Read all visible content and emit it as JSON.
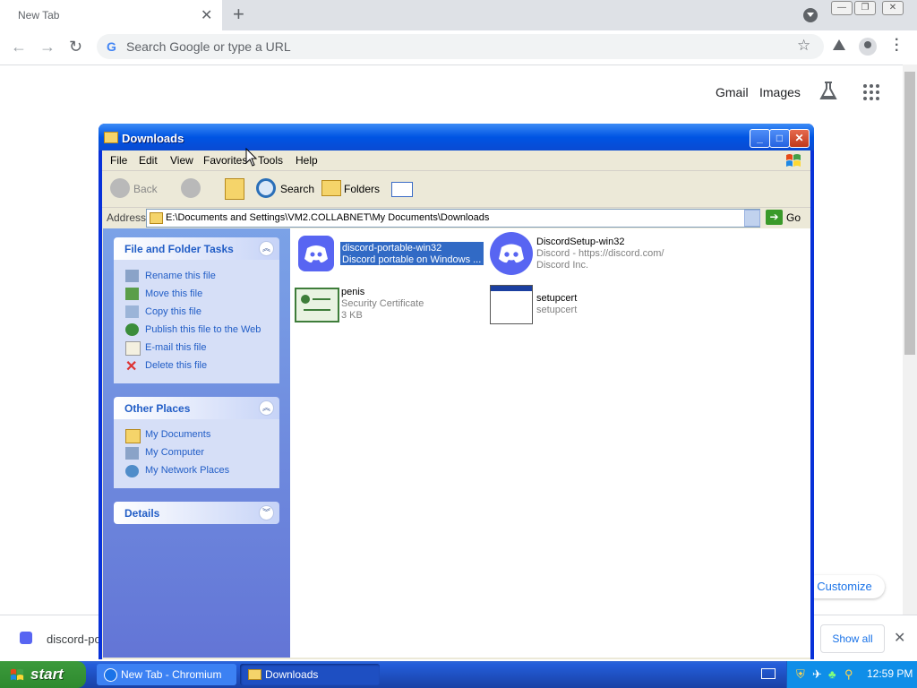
{
  "browser": {
    "tab_title": "New Tab",
    "omnibox_placeholder": "Search Google or type a URL",
    "ntp": {
      "gmail": "Gmail",
      "images": "Images",
      "customize": "Customize"
    },
    "download_bar": {
      "file_name": "discord-por",
      "show_all": "Show all"
    }
  },
  "explorer": {
    "title": "Downloads",
    "menu": [
      "File",
      "Edit",
      "View",
      "Favorites",
      "Tools",
      "Help"
    ],
    "toolbar": {
      "back": "Back",
      "search": "Search",
      "folders": "Folders"
    },
    "address": {
      "label": "Address",
      "path": "E:\\Documents and Settings\\VM2.COLLABNET\\My Documents\\Downloads",
      "go": "Go"
    },
    "file_tasks": {
      "header": "File and Folder Tasks",
      "items": [
        "Rename this file",
        "Move this file",
        "Copy this file",
        "Publish this file to the Web",
        "E-mail this file",
        "Delete this file"
      ]
    },
    "other_places": {
      "header": "Other Places",
      "items": [
        "My Documents",
        "My Computer",
        "My Network Places"
      ]
    },
    "details": {
      "header": "Details"
    },
    "files": [
      {
        "name": "discord-portable-win32",
        "line2": "Discord portable on Windows ...",
        "line3": "",
        "selected": true
      },
      {
        "name": "DiscordSetup-win32",
        "line2": "Discord - https://discord.com/",
        "line3": "Discord Inc.",
        "selected": false
      },
      {
        "name": "penis",
        "line2": "Security Certificate",
        "line3": "3 KB",
        "selected": false
      },
      {
        "name": "setupcert",
        "line2": "setupcert",
        "line3": "",
        "selected": false
      }
    ]
  },
  "taskbar": {
    "start": "start",
    "buttons": [
      "New Tab - Chromium",
      "Downloads"
    ],
    "clock": "12:59 PM"
  },
  "colors": {
    "xp_blue": "#0054e3",
    "discord": "#5865f2",
    "selection": "#316ac5"
  }
}
